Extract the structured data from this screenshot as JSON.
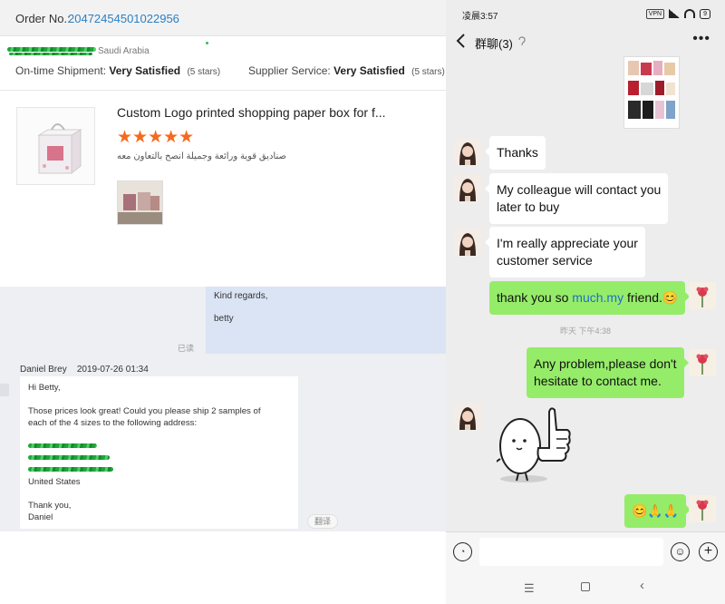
{
  "order": {
    "label": "Order No.:",
    "number": "20472454501022956"
  },
  "review": {
    "country": "Saudi Arabia",
    "shipment_label": "On-time Shipment:",
    "shipment_value": "Very Satisfied",
    "shipment_stars": "(5 stars)",
    "supplier_label": "Supplier Service:",
    "supplier_value": "Very Satisfied",
    "supplier_stars": "(5 stars)"
  },
  "product": {
    "title": "Custom Logo printed shopping paper box for f...",
    "rating_stars": "★★★★★",
    "rating_value": 5,
    "review_text": "صناديق قوية ورائعة وجميلة انصح بالتعاون معه"
  },
  "thread": {
    "reply_line1": "Kind regards,",
    "reply_line2": "betty",
    "read_status": "已读",
    "sender_name": "Daniel Brey",
    "sender_time": "2019-07-26 01:34",
    "message": {
      "greeting": "Hi Betty,",
      "line1": "Those prices look great! Could you please ship 2 samples of",
      "line2": "each of the 4 sizes to the following address:",
      "country": "United States",
      "closing": "Thank you,",
      "signature": "Daniel"
    },
    "translate_label": "翻译"
  },
  "phone": {
    "status_time": "凌晨3:57",
    "vpn": "VPN",
    "battery": "9",
    "chat_title": "群聊(3)",
    "more": "•••",
    "messages": {
      "thanks": "Thanks",
      "colleague_1": "My colleague will contact you",
      "colleague_2": "later to buy",
      "appreciate_1": "I'm really appreciate your",
      "appreciate_2": "customer service",
      "thankyou_a": "thank you so ",
      "thankyou_link": "much.my",
      "thankyou_b": " friend.",
      "thankyou_emoji": "😊",
      "timestamp": "昨天 下午4:38",
      "problem_1": "Any problem,please don't",
      "problem_2": "hesitate to contact me.",
      "emoji_msg": "😊🙏🙏"
    },
    "input_placeholder": "",
    "nav": {
      "menu": "☰",
      "back": "‹"
    }
  },
  "colors": {
    "accent_link": "#2c7fc2",
    "star_orange": "#f56a1e",
    "wechat_green": "#95ec69",
    "reply_blue": "#dbe4f5"
  }
}
